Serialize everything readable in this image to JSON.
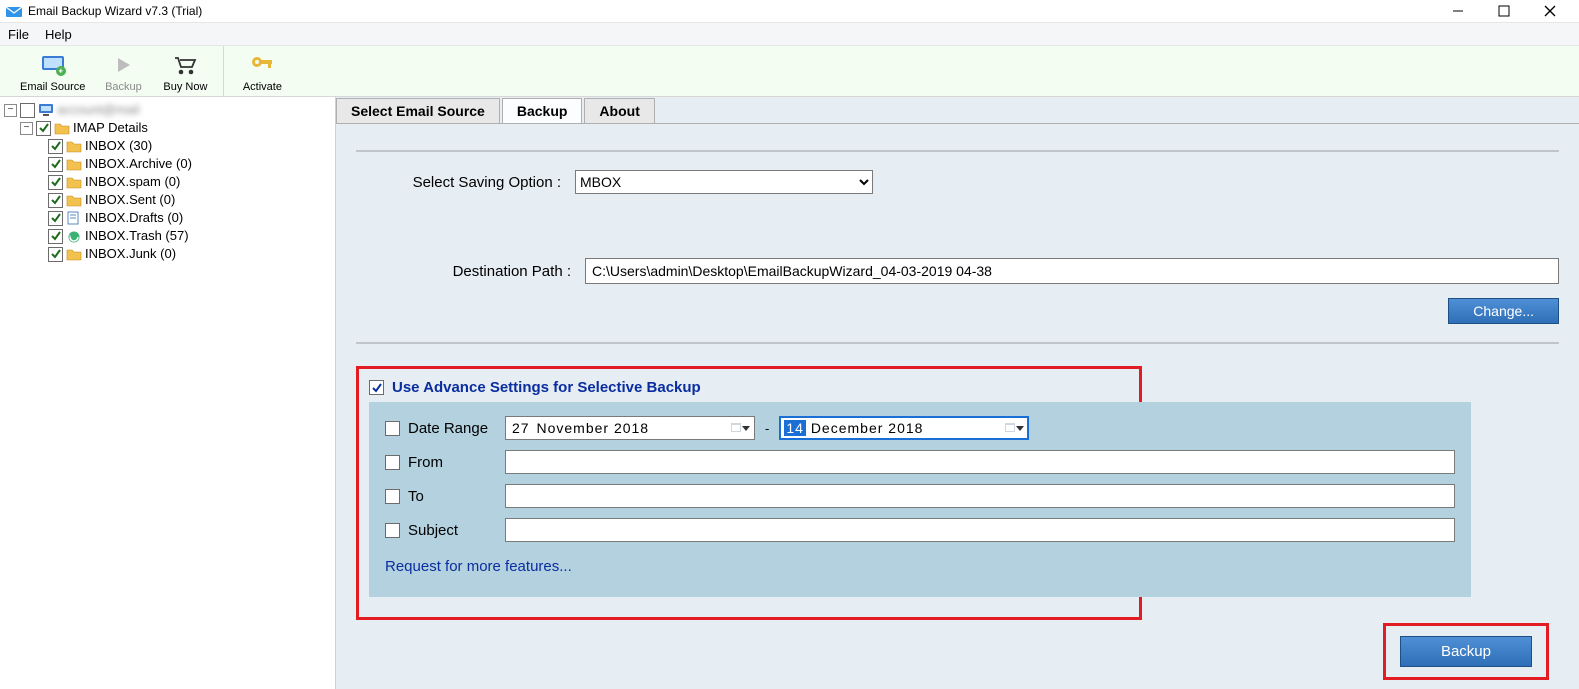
{
  "window": {
    "title": "Email Backup Wizard v7.3 (Trial)"
  },
  "menu": {
    "file": "File",
    "help": "Help"
  },
  "toolbar": {
    "email_source": "Email Source",
    "backup": "Backup",
    "buy_now": "Buy Now",
    "activate": "Activate"
  },
  "tree": {
    "root": "IMAP Details",
    "items": [
      "INBOX (30)",
      "INBOX.Archive (0)",
      "INBOX.spam (0)",
      "INBOX.Sent (0)",
      "INBOX.Drafts (0)",
      "INBOX.Trash (57)",
      "INBOX.Junk (0)"
    ]
  },
  "tabs": {
    "select_source": "Select Email Source",
    "backup": "Backup",
    "about": "About"
  },
  "form": {
    "saving_label": "Select Saving Option  :",
    "saving_value": "MBOX",
    "dest_label": "Destination Path  :",
    "dest_value": "C:\\Users\\admin\\Desktop\\EmailBackupWizard_04-03-2019 04-38",
    "change": "Change...",
    "adv_label": "Use Advance Settings for Selective Backup",
    "date_range": "Date Range",
    "date_from_day": "27",
    "date_from_rest": "November  2018",
    "date_sep": "-",
    "date_to_day": "14",
    "date_to_rest": "December  2018",
    "from": "From",
    "to": "To",
    "subject": "Subject",
    "request": "Request for more features...",
    "backup_btn": "Backup"
  }
}
